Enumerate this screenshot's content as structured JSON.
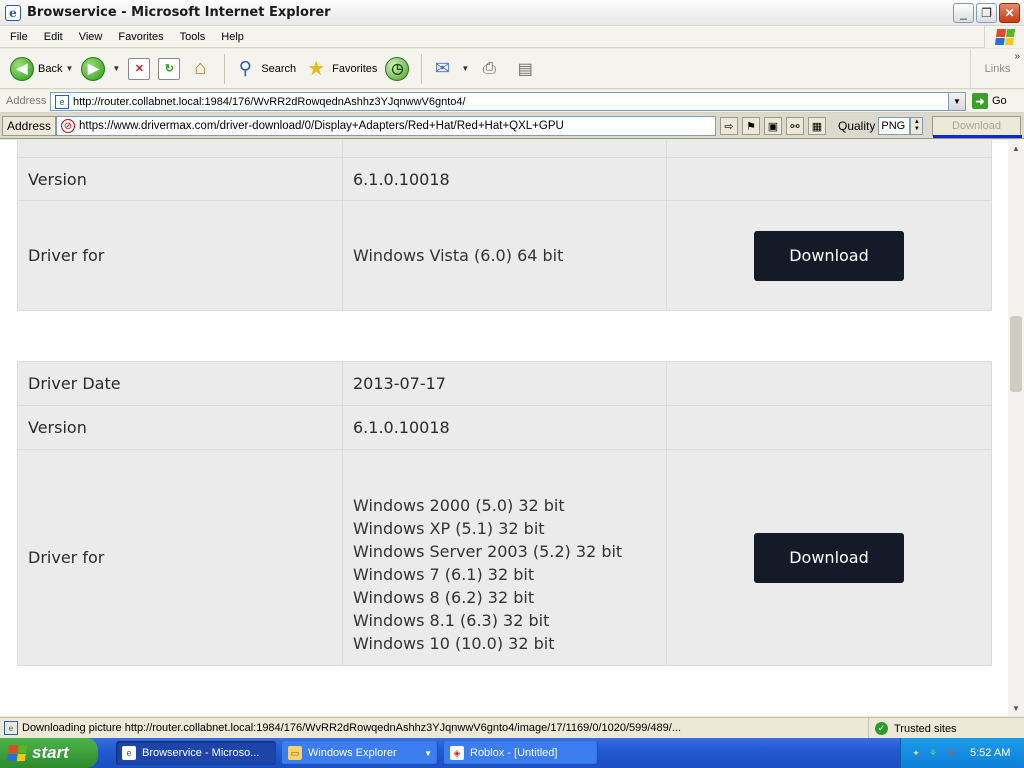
{
  "window": {
    "title": "Browservice - Microsoft Internet Explorer",
    "buttons": {
      "minimize": "_",
      "restore": "❐",
      "close": "✕"
    }
  },
  "menu": [
    "File",
    "Edit",
    "View",
    "Favorites",
    "Tools",
    "Help"
  ],
  "toolbar": {
    "back_label": "Back",
    "search_label": "Search",
    "favorites_label": "Favorites",
    "links_label": "Links"
  },
  "address": {
    "label": "Address",
    "url": "http://router.collabnet.local:1984/176/WvRR2dRowqednAshhz3YJqnwwV6gnto4/",
    "go_label": "Go"
  },
  "proxy": {
    "label": "Address",
    "url": "https://www.drivermax.com/driver-download/0/Display+Adapters/Red+Hat/Red+Hat+QXL+GPU",
    "quality_label": "Quality",
    "quality_value": "PNG",
    "download_label": "Download"
  },
  "page": {
    "card1": {
      "version_label": "Version",
      "version_value": "6.1.0.10018",
      "driver_for_label": "Driver for",
      "driver_for": [
        "Windows Vista (6.0) 64 bit"
      ],
      "download_label": "Download"
    },
    "card2": {
      "date_label": "Driver Date",
      "date_value": "2013-07-17",
      "version_label": "Version",
      "version_value": "6.1.0.10018",
      "driver_for_label": "Driver for",
      "driver_for": [
        "Windows 2000 (5.0) 32 bit",
        "Windows XP (5.1) 32 bit",
        "Windows Server 2003 (5.2) 32 bit",
        "Windows 7 (6.1) 32 bit",
        "Windows 8 (6.2) 32 bit",
        "Windows 8.1 (6.3) 32 bit",
        "Windows 10 (10.0) 32 bit"
      ],
      "download_label": "Download"
    }
  },
  "status": {
    "text": "Downloading picture http://router.collabnet.local:1984/176/WvRR2dRowqednAshhz3YJqnwwV6gnto4/image/17/1169/0/1020/599/489/...",
    "zone": "Trusted sites"
  },
  "taskbar": {
    "start_label": "start",
    "tasks": [
      {
        "label": "Browservice - Microso...",
        "active": true
      },
      {
        "label": "Windows Explorer",
        "active": false
      },
      {
        "label": "Roblox - [Untitled]",
        "active": false
      }
    ],
    "clock": "5:52 AM"
  }
}
